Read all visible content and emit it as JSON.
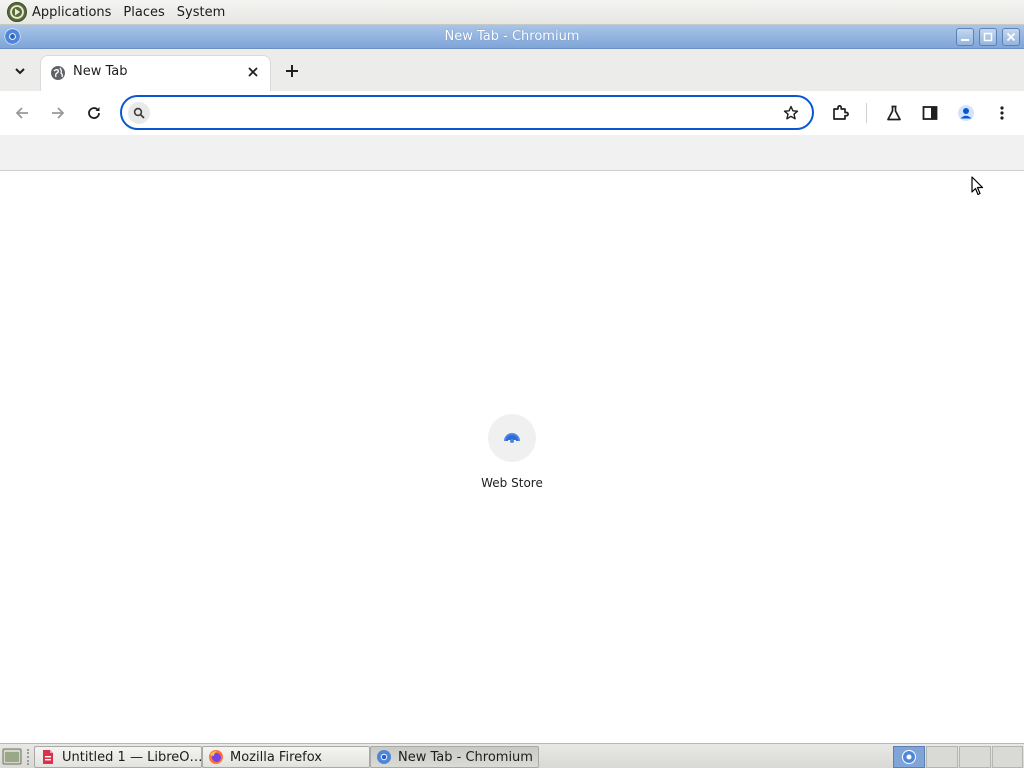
{
  "top_panel": {
    "menus": [
      "Applications",
      "Places",
      "System"
    ]
  },
  "window": {
    "title": "New Tab - Chromium"
  },
  "tabs": [
    {
      "title": "New Tab",
      "favicon": "globe-icon",
      "active": true
    }
  ],
  "toolbar": {
    "search_placeholder": "",
    "search_value": ""
  },
  "shortcuts": [
    {
      "label": "Web Store",
      "icon": "web-store-icon"
    }
  ],
  "taskbar": {
    "items": [
      {
        "label": "Untitled 1 — LibreO…",
        "icon": "libreoffice-icon"
      },
      {
        "label": "Mozilla Firefox",
        "icon": "firefox-icon"
      },
      {
        "label": "New Tab - Chromium",
        "icon": "chromium-icon",
        "active": true
      }
    ]
  },
  "colors": {
    "accent": "#0b57d0",
    "titlebar": "#8fb0de"
  }
}
